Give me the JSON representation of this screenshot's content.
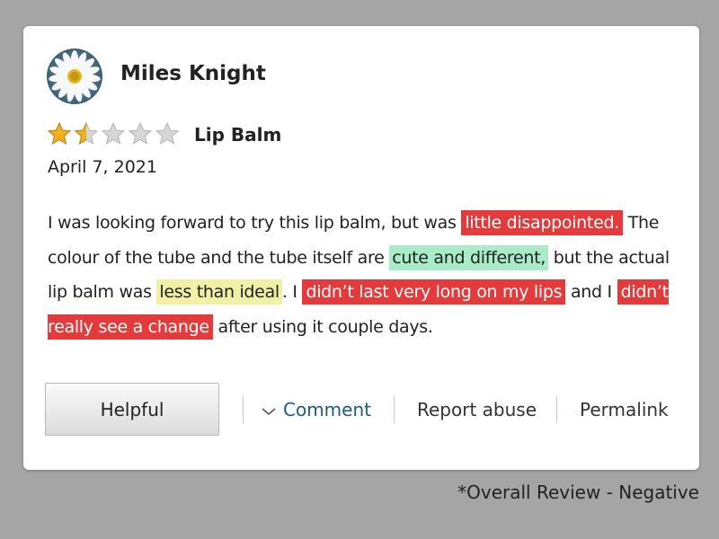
{
  "reviewer": {
    "name": "Miles Knight",
    "avatar_icon": "daisy-avatar-icon"
  },
  "rating": {
    "value": 1.5,
    "max": 5,
    "filled_color": "#f0b020",
    "empty_color": "#d6d6d6"
  },
  "product": {
    "name": "Lip Balm"
  },
  "date": "April 7, 2021",
  "review": {
    "segments": [
      {
        "text": "I was looking forward to try this lip balm, but was ",
        "highlight": null
      },
      {
        "text": "little disappointed.",
        "highlight": "negative"
      },
      {
        "text": " The colour of the tube and the tube itself are ",
        "highlight": null
      },
      {
        "text": "cute and different,",
        "highlight": "positive"
      },
      {
        "text": " but the actual lip balm was ",
        "highlight": null
      },
      {
        "text": "less than ideal",
        "highlight": "neutral"
      },
      {
        "text": ". I ",
        "highlight": null
      },
      {
        "text": "didn’t last very long on my lips",
        "highlight": "negative"
      },
      {
        "text": " and I ",
        "highlight": null
      },
      {
        "text": "didn’t really see a change",
        "highlight": "negative"
      },
      {
        "text": " after using it couple days.",
        "highlight": null
      }
    ],
    "highlight_colors": {
      "negative": "#e33b3b",
      "positive": "#a8ecc8",
      "neutral": "#f0f1a6"
    }
  },
  "actions": {
    "helpful_label": "Helpful",
    "comment_label": "Comment",
    "comment_icon": "chevron-down-icon",
    "report_label": "Report abuse",
    "permalink_label": "Permalink"
  },
  "footnote": "*Overall Review - Negative"
}
